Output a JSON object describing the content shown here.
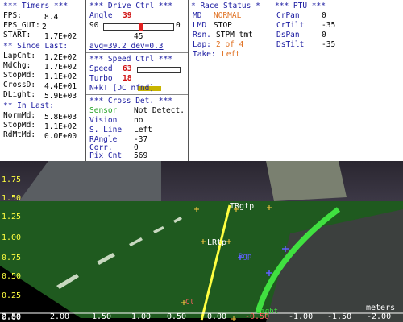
{
  "timers": {
    "header": "*** Timers ***",
    "fps_label": "FPS:",
    "fps": "8.4",
    "fps_gui_label": "FPS_GUI:",
    "fps_gui": "2",
    "start_label": "START:",
    "start": "1.7E+02",
    "since_header": "** Since Last:",
    "lapcnt_label": "LapCnt:",
    "lapcnt": "1.2E+02",
    "mdchg_label": "MdChg:",
    "mdchg": "1.7E+02",
    "stopmd_label": "StopMd:",
    "stopmd": "1.1E+02",
    "crossd_label": "CrossD:",
    "crossd": "4.4E+01",
    "dlight_label": "DLight:",
    "dlight": "5.9E+03",
    "in_header": "** In Last:",
    "normmd_label": "NormMd:",
    "normmd": "5.8E+03",
    "stopmd2_label": "StopMd:",
    "stopmd2": "1.1E+02",
    "rdmtmd_label": "RdMtMd:",
    "rdmtmd": "0.0E+00"
  },
  "drive": {
    "header": "*** Drive Ctrl ***",
    "angle_label": "Angle",
    "angle": "39",
    "slider_min": "90",
    "slider_max": "0",
    "slider_value": "45",
    "avg_text": "avg=39.2 dev=0.3",
    "speed_header": "*** Speed Ctrl ***",
    "speed_label": "Speed",
    "speed": "63",
    "speed_level": 0.55,
    "turbo_label": "Turbo",
    "turbo": "18",
    "nkt_text": "N+kT [DC nfnd]",
    "cross_header": "*** Cross Det. ***",
    "sensor_label": "Sensor",
    "sensor_value": "Not Detect.",
    "vision_label": "Vision",
    "vision_value": "no",
    "sline_label": "S. Line",
    "sline_value": "Left",
    "rangle_label": "RAngle",
    "rangle_value": "-37",
    "corr_label": "Corr.",
    "corr_value": "0",
    "pixcnt_label": "Pix Cnt",
    "pixcnt_value": "569"
  },
  "race": {
    "header": "* Race Status *",
    "md_label": "MD",
    "md_value": "NORMAL",
    "lmd_label": "LMD",
    "lmd_value": "STOP",
    "rsn_label": "Rsn.",
    "rsn_value": "STPM tmt",
    "lap_label": "Lap:",
    "lap_value": "2 of 4",
    "take_label": "Take:",
    "take_value": "Left"
  },
  "ptu": {
    "header": "*** PTU ***",
    "crpan_label": "CrPan",
    "crpan": "0",
    "crtilt_label": "CrTilt",
    "crtilt": "-35",
    "dspan_label": "DsPan",
    "dspan": "0",
    "dstilt_label": "DsTilt",
    "dstilt": "-35"
  },
  "scene": {
    "y_ticks": [
      "1.75",
      "1.50",
      "1.25",
      "1.00",
      "0.75",
      "0.50",
      "0.25",
      "0.00"
    ],
    "x_ticks": [
      "2.00",
      "1.50",
      "1.00",
      "0.50",
      "0.00",
      "-0.50",
      "-1.00",
      "-1.50",
      "-2.00"
    ],
    "x_ticks_first": "2.50",
    "unit_label": "meters",
    "label_rgtp": "TRgtp",
    "label_lrtp": "LRtp",
    "label_rgp": "Rgp",
    "label_light": "Light",
    "label_cl": "Cl",
    "colors": {
      "yellow": "#ffff40",
      "green": "#40e040",
      "grass": "#1f5a1f"
    }
  }
}
